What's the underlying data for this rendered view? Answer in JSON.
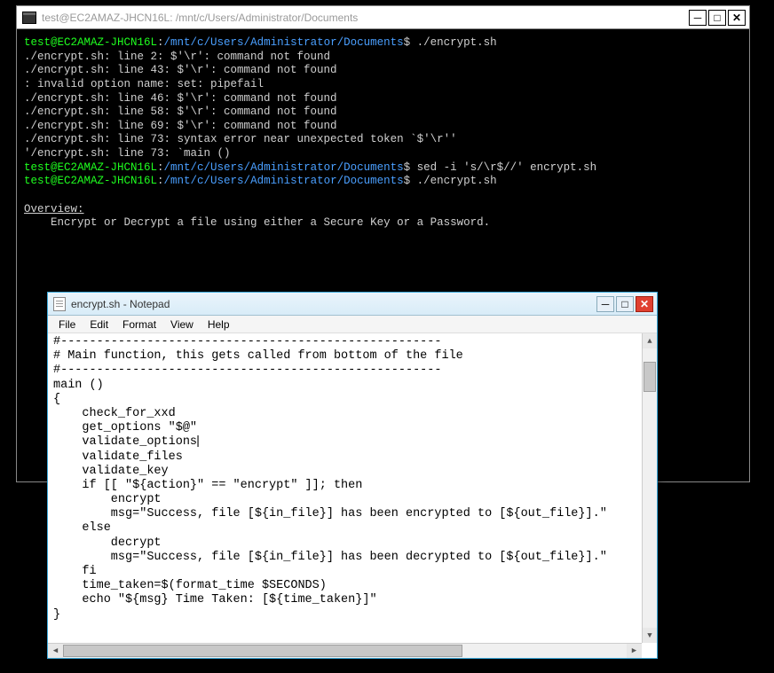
{
  "terminal": {
    "title": "test@EC2AMAZ-JHCN16L: /mnt/c/Users/Administrator/Documents",
    "prompt_user": "test@EC2AMAZ-JHCN16L",
    "prompt_sep": ":",
    "prompt_path": "/mnt/c/Users/Administrator/Documents",
    "prompt_suffix": "$",
    "lines": [
      {
        "type": "prompt",
        "cmd": " ./encrypt.sh"
      },
      {
        "type": "out",
        "text": "./encrypt.sh: line 2: $'\\r': command not found"
      },
      {
        "type": "out",
        "text": "./encrypt.sh: line 43: $'\\r': command not found"
      },
      {
        "type": "out",
        "text": ": invalid option name: set: pipefail"
      },
      {
        "type": "out",
        "text": "./encrypt.sh: line 46: $'\\r': command not found"
      },
      {
        "type": "out",
        "text": "./encrypt.sh: line 58: $'\\r': command not found"
      },
      {
        "type": "out",
        "text": "./encrypt.sh: line 69: $'\\r': command not found"
      },
      {
        "type": "out",
        "text": "./encrypt.sh: line 73: syntax error near unexpected token `$'\\r''"
      },
      {
        "type": "out",
        "text": "'/encrypt.sh: line 73: `main ()"
      },
      {
        "type": "prompt",
        "cmd": " sed -i 's/\\r$//' encrypt.sh"
      },
      {
        "type": "prompt",
        "cmd": " ./encrypt.sh"
      },
      {
        "type": "blank",
        "text": ""
      },
      {
        "type": "underline",
        "text": "Overview:"
      },
      {
        "type": "out",
        "text": "    Encrypt or Decrypt a file using either a Secure Key or a Password."
      }
    ],
    "controls": {
      "min": "─",
      "max": "□",
      "close": "✕"
    }
  },
  "notepad": {
    "title": "encrypt.sh - Notepad",
    "menu": [
      "File",
      "Edit",
      "Format",
      "View",
      "Help"
    ],
    "content": "#-----------------------------------------------------\n# Main function, this gets called from bottom of the file\n#-----------------------------------------------------\nmain ()\n{\n    check_for_xxd\n    get_options \"$@\"\n    validate_options\n    validate_files\n    validate_key\n    if [[ \"${action}\" == \"encrypt\" ]]; then\n        encrypt\n        msg=\"Success, file [${in_file}] has been encrypted to [${out_file}].\"\n    else\n        decrypt\n        msg=\"Success, file [${in_file}] has been decrypted to [${out_file}].\"\n    fi\n    time_taken=$(format_time $SECONDS)\n    echo \"${msg} Time Taken: [${time_taken}]\"\n}",
    "controls": {
      "min": "─",
      "max": "□",
      "close": "✕"
    }
  }
}
